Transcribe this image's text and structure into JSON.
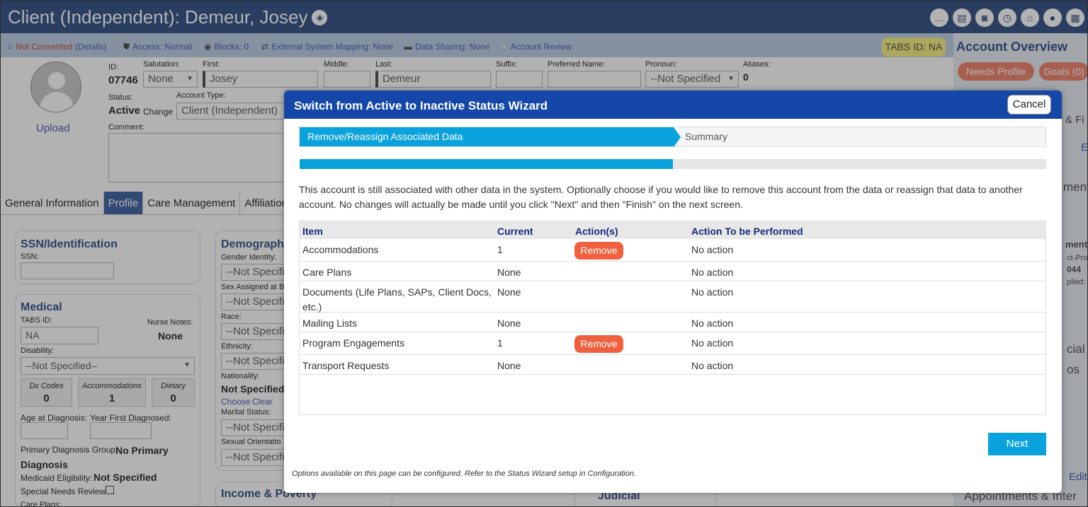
{
  "app": {
    "title": "Client (Independent): Demeur, Josey",
    "top_icons": [
      "chat-icon",
      "id-card-icon",
      "camera-icon",
      "clock-icon",
      "basket-icon",
      "user-icon",
      "building-icon"
    ]
  },
  "statusbar": {
    "consent": "Not Consented",
    "consent_details": "(Details)",
    "access": "Access: Normal",
    "blocks": "Blocks: 0",
    "ext_mapping": "External System Mapping: None",
    "data_sharing": "Data Sharing: None",
    "account_review": "Account Review",
    "tabs_id": "TABS ID: NA"
  },
  "overview": {
    "title": "Account Overview",
    "needs_profile": "Needs Profile",
    "goals": "Goals (0)"
  },
  "client": {
    "id_label": "ID:",
    "id": "07746",
    "salutation_label": "Salutation:",
    "salutation": "None",
    "first_label": "First:",
    "first": "Josey",
    "middle_label": "Middle:",
    "last_label": "Last:",
    "last": "Demeur",
    "suffix_label": "Suffix:",
    "preferred_label": "Preferred Name:",
    "pronoun_label": "Pronoun:",
    "pronoun": "--Not Specified",
    "aliases_label": "Aliases:",
    "aliases": "0",
    "status_label": "Status:",
    "status": "Active",
    "change": "Change",
    "account_type_label": "Account Type:",
    "account_type": "Client (Independent)",
    "comment_label": "Comment:",
    "upload": "Upload"
  },
  "tabs": [
    "General Information",
    "Profile",
    "Care Management",
    "Affiliation"
  ],
  "profile": {
    "ssn_title": "SSN/Identification",
    "ssn_label": "SSN:",
    "medical_title": "Medical",
    "tabs_id_label": "TABS ID:",
    "tabs_id_value": "NA",
    "nurse_notes_label": "Nurse Notes:",
    "nurse_notes": "None",
    "disability_label": "Disability:",
    "disability": "--Not Specified--",
    "dx_codes": "Dx Codes",
    "dx_codes_n": "0",
    "accommodations": "Accommodations",
    "accommodations_n": "1",
    "dietary": "Dietary",
    "dietary_n": "0",
    "age_diag_label": "Age at Diagnosis:",
    "year_diag_label": "Year First Diagnosed:",
    "primary_diag_label": "Primary Diagnosis Group:",
    "primary_diag": "No Primary Diagnosis",
    "medicaid_label": "Medicaid Eligibility:",
    "medicaid": "Not Specified",
    "special_needs_label": "Special Needs Review:",
    "care_plans_label": "Care Plans:",
    "demographics_title": "Demograph",
    "gender_label": "Gender Identity:",
    "not_specified": "--Not Specifi",
    "sex_label": "Sex Assigned at B",
    "race_label": "Race:",
    "ethnicity_label": "Ethnicity:",
    "nationality_label": "Nationality:",
    "nationality": "Not Specified",
    "choose": "Choose",
    "clear": "Clear",
    "marital_label": "Marital Status:",
    "sexual_label": "Sexual Orientatio",
    "income_title": "Income & Poverty",
    "judicial_title": "Judicial"
  },
  "right_fragments": [
    "& Fi",
    "E",
    "ment",
    "ment",
    "ct-Pro",
    "044",
    "plied:",
    "cial",
    "os",
    "Edit",
    "Appointments & Inter"
  ],
  "modal": {
    "title": "Switch from Active to Inactive Status Wizard",
    "cancel": "Cancel",
    "steps": [
      "Remove/Reassign Associated Data",
      "Summary"
    ],
    "progress": 0.5,
    "description": "This account is still associated with other data in the system. Optionally choose if you would like to remove this account from the data or reassign that data to another account. No changes will actually be made until you click \"Next\" and then \"Finish\" on the next screen.",
    "columns": [
      "Item",
      "Current",
      "Action(s)",
      "Action To be Performed"
    ],
    "rows": [
      {
        "item": "Accommodations",
        "current": "1",
        "action": "Remove",
        "performed": "No action"
      },
      {
        "item": "Care Plans",
        "current": "None",
        "action": "",
        "performed": "No action"
      },
      {
        "item": "Documents (Life Plans, SAPs, Client Docs, etc.)",
        "current": "None",
        "action": "",
        "performed": "No action"
      },
      {
        "item": "Mailing Lists",
        "current": "None",
        "action": "",
        "performed": "No action"
      },
      {
        "item": "Program Engagements",
        "current": "1",
        "action": "Remove",
        "performed": "No action"
      },
      {
        "item": "Transport Requests",
        "current": "None",
        "action": "",
        "performed": "No action"
      }
    ],
    "next": "Next",
    "footnote": "Options available on this page can be configured. Refer to the Status Wizard setup in Configuration."
  }
}
